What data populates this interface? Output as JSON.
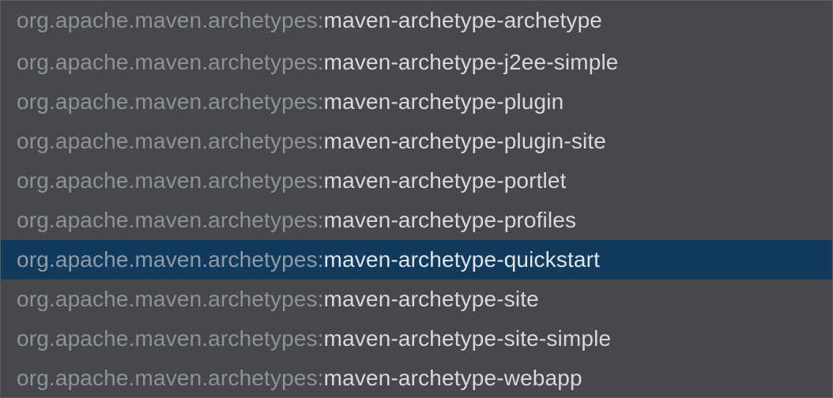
{
  "popup": {
    "items": [
      {
        "group": "org.apache.maven.archetypes:",
        "artifact": "maven-archetype-archetype",
        "selected": false
      },
      {
        "group": "org.apache.maven.archetypes:",
        "artifact": "maven-archetype-j2ee-simple",
        "selected": false
      },
      {
        "group": "org.apache.maven.archetypes:",
        "artifact": "maven-archetype-plugin",
        "selected": false
      },
      {
        "group": "org.apache.maven.archetypes:",
        "artifact": "maven-archetype-plugin-site",
        "selected": false
      },
      {
        "group": "org.apache.maven.archetypes:",
        "artifact": "maven-archetype-portlet",
        "selected": false
      },
      {
        "group": "org.apache.maven.archetypes:",
        "artifact": "maven-archetype-profiles",
        "selected": false
      },
      {
        "group": "org.apache.maven.archetypes:",
        "artifact": "maven-archetype-quickstart",
        "selected": true
      },
      {
        "group": "org.apache.maven.archetypes:",
        "artifact": "maven-archetype-site",
        "selected": false
      },
      {
        "group": "org.apache.maven.archetypes:",
        "artifact": "maven-archetype-site-simple",
        "selected": false
      },
      {
        "group": "org.apache.maven.archetypes:",
        "artifact": "maven-archetype-webapp",
        "selected": false
      }
    ],
    "colors": {
      "background": "#46484b",
      "selection": "#113a5d",
      "group_text": "#8f9296",
      "artifact_text": "#d7d9dc"
    }
  }
}
